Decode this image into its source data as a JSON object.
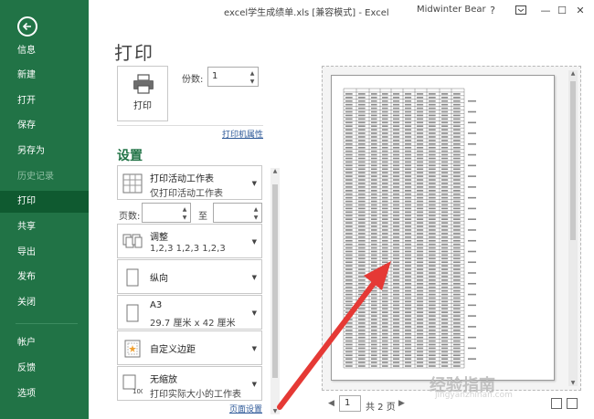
{
  "window": {
    "title": "excel学生成绩单.xls  [兼容模式]  -  Excel",
    "user": "Midwinter Bear",
    "help_glyph": "?",
    "minimize_glyph": "—",
    "restore_glyph": "☐",
    "close_glyph": "✕"
  },
  "sidebar": {
    "items": [
      {
        "label": "信息",
        "state": "normal"
      },
      {
        "label": "新建",
        "state": "normal"
      },
      {
        "label": "打开",
        "state": "normal"
      },
      {
        "label": "保存",
        "state": "normal"
      },
      {
        "label": "另存为",
        "state": "normal"
      },
      {
        "label": "历史记录",
        "state": "disabled"
      },
      {
        "label": "打印",
        "state": "active"
      },
      {
        "label": "共享",
        "state": "normal"
      },
      {
        "label": "导出",
        "state": "normal"
      },
      {
        "label": "发布",
        "state": "normal"
      },
      {
        "label": "关闭",
        "state": "normal"
      },
      {
        "label": "帐户",
        "state": "normal"
      },
      {
        "label": "反馈",
        "state": "normal"
      },
      {
        "label": "选项",
        "state": "normal"
      }
    ]
  },
  "print": {
    "title": "打印",
    "button_label": "打印",
    "copies_label": "份数:",
    "copies_value": "1",
    "printer_properties": "打印机属性"
  },
  "settings": {
    "title": "设置",
    "what": {
      "line1": "打印活动工作表",
      "line2": "仅打印活动工作表"
    },
    "pages_label": "页数:",
    "to_label": "至",
    "collate": {
      "line1": "调整",
      "line2": "1,2,3    1,2,3    1,2,3"
    },
    "orientation": {
      "line1": "纵向"
    },
    "paper": {
      "line1": "A3",
      "line2": "29.7 厘米 x 42 厘米"
    },
    "margins": {
      "line1": "自定义边距"
    },
    "scaling": {
      "line1": "无缩放",
      "line2": "打印实际大小的工作表",
      "icon_text": "100"
    },
    "page_setup": "页面设置"
  },
  "preview": {
    "current_page": "1",
    "total_pages": "共 2 页"
  },
  "watermark": {
    "main": "经验指南",
    "sub": "jingyanzhinan.com"
  },
  "colors": {
    "sidebar": "#217346",
    "sidebar_active": "#0f5a30",
    "accent": "#217346",
    "arrow": "#e53935",
    "link": "#2b5797"
  }
}
